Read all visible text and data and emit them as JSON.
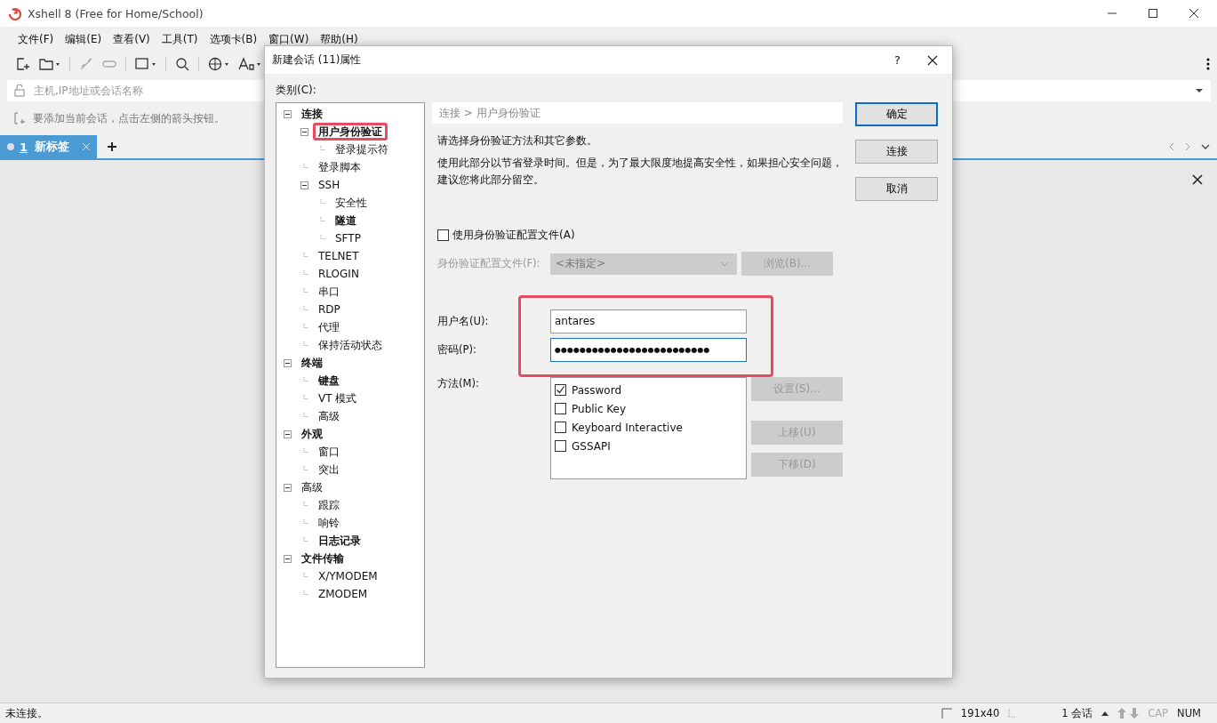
{
  "window": {
    "title": "Xshell 8 (Free for Home/School)"
  },
  "menu": [
    "文件(F)",
    "编辑(E)",
    "查看(V)",
    "工具(T)",
    "选项卡(B)",
    "窗口(W)",
    "帮助(H)"
  ],
  "address": {
    "placeholder": "主机,IP地址或会话名称"
  },
  "hint": "要添加当前会话，点击左侧的箭头按钮。",
  "tabs": [
    {
      "number": "1",
      "label": "新标签",
      "selected": true
    }
  ],
  "dialog": {
    "title": "新建会话 (11)属性",
    "help": "?",
    "category_label": "类别(C):",
    "tree": [
      {
        "label": "连接",
        "modified": true,
        "expanded": true,
        "highlighted": false,
        "children": [
          {
            "label": "用户身份验证",
            "modified": true,
            "expanded": true,
            "highlighted": true,
            "children": [
              {
                "label": "登录提示符",
                "modified": false,
                "highlighted": false
              }
            ]
          },
          {
            "label": "登录脚本",
            "modified": false,
            "highlighted": false
          },
          {
            "label": "SSH",
            "modified": false,
            "expanded": true,
            "highlighted": false,
            "children": [
              {
                "label": "安全性",
                "modified": false,
                "highlighted": false
              },
              {
                "label": "隧道",
                "modified": true,
                "highlighted": false
              },
              {
                "label": "SFTP",
                "modified": false,
                "highlighted": false
              }
            ]
          },
          {
            "label": "TELNET",
            "modified": false,
            "highlighted": false
          },
          {
            "label": "RLOGIN",
            "modified": false,
            "highlighted": false
          },
          {
            "label": "串口",
            "modified": false,
            "highlighted": false
          },
          {
            "label": "RDP",
            "modified": false,
            "highlighted": false
          },
          {
            "label": "代理",
            "modified": false,
            "highlighted": false
          },
          {
            "label": "保持活动状态",
            "modified": false,
            "highlighted": false
          }
        ]
      },
      {
        "label": "终端",
        "modified": true,
        "expanded": true,
        "highlighted": false,
        "children": [
          {
            "label": "键盘",
            "modified": true,
            "highlighted": false
          },
          {
            "label": "VT 模式",
            "modified": false,
            "highlighted": false
          },
          {
            "label": "高级",
            "modified": false,
            "highlighted": false
          }
        ]
      },
      {
        "label": "外观",
        "modified": true,
        "expanded": true,
        "highlighted": false,
        "children": [
          {
            "label": "窗口",
            "modified": false,
            "highlighted": false
          },
          {
            "label": "突出",
            "modified": false,
            "highlighted": false
          }
        ]
      },
      {
        "label": "高级",
        "modified": false,
        "expanded": true,
        "highlighted": false,
        "children": [
          {
            "label": "跟踪",
            "modified": false,
            "highlighted": false
          },
          {
            "label": "响铃",
            "modified": false,
            "highlighted": false
          },
          {
            "label": "日志记录",
            "modified": true,
            "highlighted": false
          }
        ]
      },
      {
        "label": "文件传输",
        "modified": true,
        "expanded": true,
        "highlighted": false,
        "children": [
          {
            "label": "X/YMODEM",
            "modified": false,
            "highlighted": false
          },
          {
            "label": "ZMODEM",
            "modified": false,
            "highlighted": false
          }
        ]
      }
    ],
    "breadcrumb": [
      "连接",
      "用户身份验证"
    ],
    "breadcrumb_sep": ">",
    "description": [
      "请选择身份验证方法和其它参数。",
      "使用此部分以节省登录时间。但是，为了最大限度地提高安全性，如果担心安全问题，建议您将此部分留空。"
    ],
    "use_profile": {
      "label": "使用身份验证配置文件(A)",
      "checked": false
    },
    "profile": {
      "label": "身份验证配置文件(F):",
      "value": "<未指定>",
      "disabled": true,
      "browse": "浏览(B)..."
    },
    "credentials_highlighted": true,
    "username": {
      "label": "用户名(U):",
      "value": "antares"
    },
    "password": {
      "label": "密码(P):",
      "value": "●●●●●●●●●●●●●●●●●●●●●●●●●"
    },
    "method": {
      "label": "方法(M):",
      "items": [
        {
          "label": "Password",
          "checked": true
        },
        {
          "label": "Public Key",
          "checked": false
        },
        {
          "label": "Keyboard Interactive",
          "checked": false
        },
        {
          "label": "GSSAPI",
          "checked": false
        }
      ],
      "buttons": [
        {
          "label": "设置(S)...",
          "disabled": true
        },
        {
          "label": "上移(U)",
          "disabled": true
        },
        {
          "label": "下移(D)",
          "disabled": true
        }
      ]
    },
    "buttons": [
      {
        "label": "确定",
        "default": true
      },
      {
        "label": "连接",
        "default": false
      },
      {
        "label": "取消",
        "default": false
      }
    ]
  },
  "status": {
    "text": "未连接。",
    "size": "191x40",
    "sessions": "1 会话",
    "cap": {
      "label": "CAP",
      "on": false
    },
    "num": {
      "label": "NUM",
      "on": true
    }
  }
}
